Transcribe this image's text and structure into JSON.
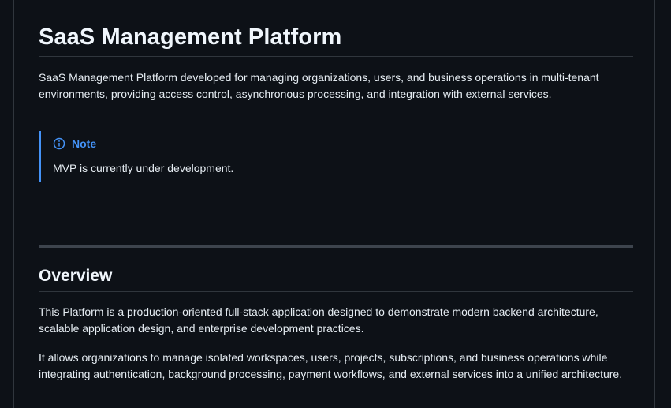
{
  "readme": {
    "title": "SaaS Management Platform",
    "intro": "SaaS Management Platform developed for managing organizations, users, and business operations in multi-tenant environments, providing access control, asynchronous processing, and integration with external services.",
    "note": {
      "icon": "info-icon",
      "label": "Note",
      "text": "MVP is currently under development."
    },
    "overview": {
      "heading": "Overview",
      "paragraph1": "This Platform is a production-oriented full-stack application designed to demonstrate modern backend architecture, scalable application design, and enterprise development practices.",
      "paragraph2": "It allows organizations to manage isolated workspaces, users, projects, subscriptions, and business operations while integrating authentication, background processing, payment workflows, and external services into a unified architecture."
    }
  },
  "colors": {
    "background": "#0d1117",
    "text": "#e6edf3",
    "accent": "#4493f8",
    "border": "#30363d"
  }
}
